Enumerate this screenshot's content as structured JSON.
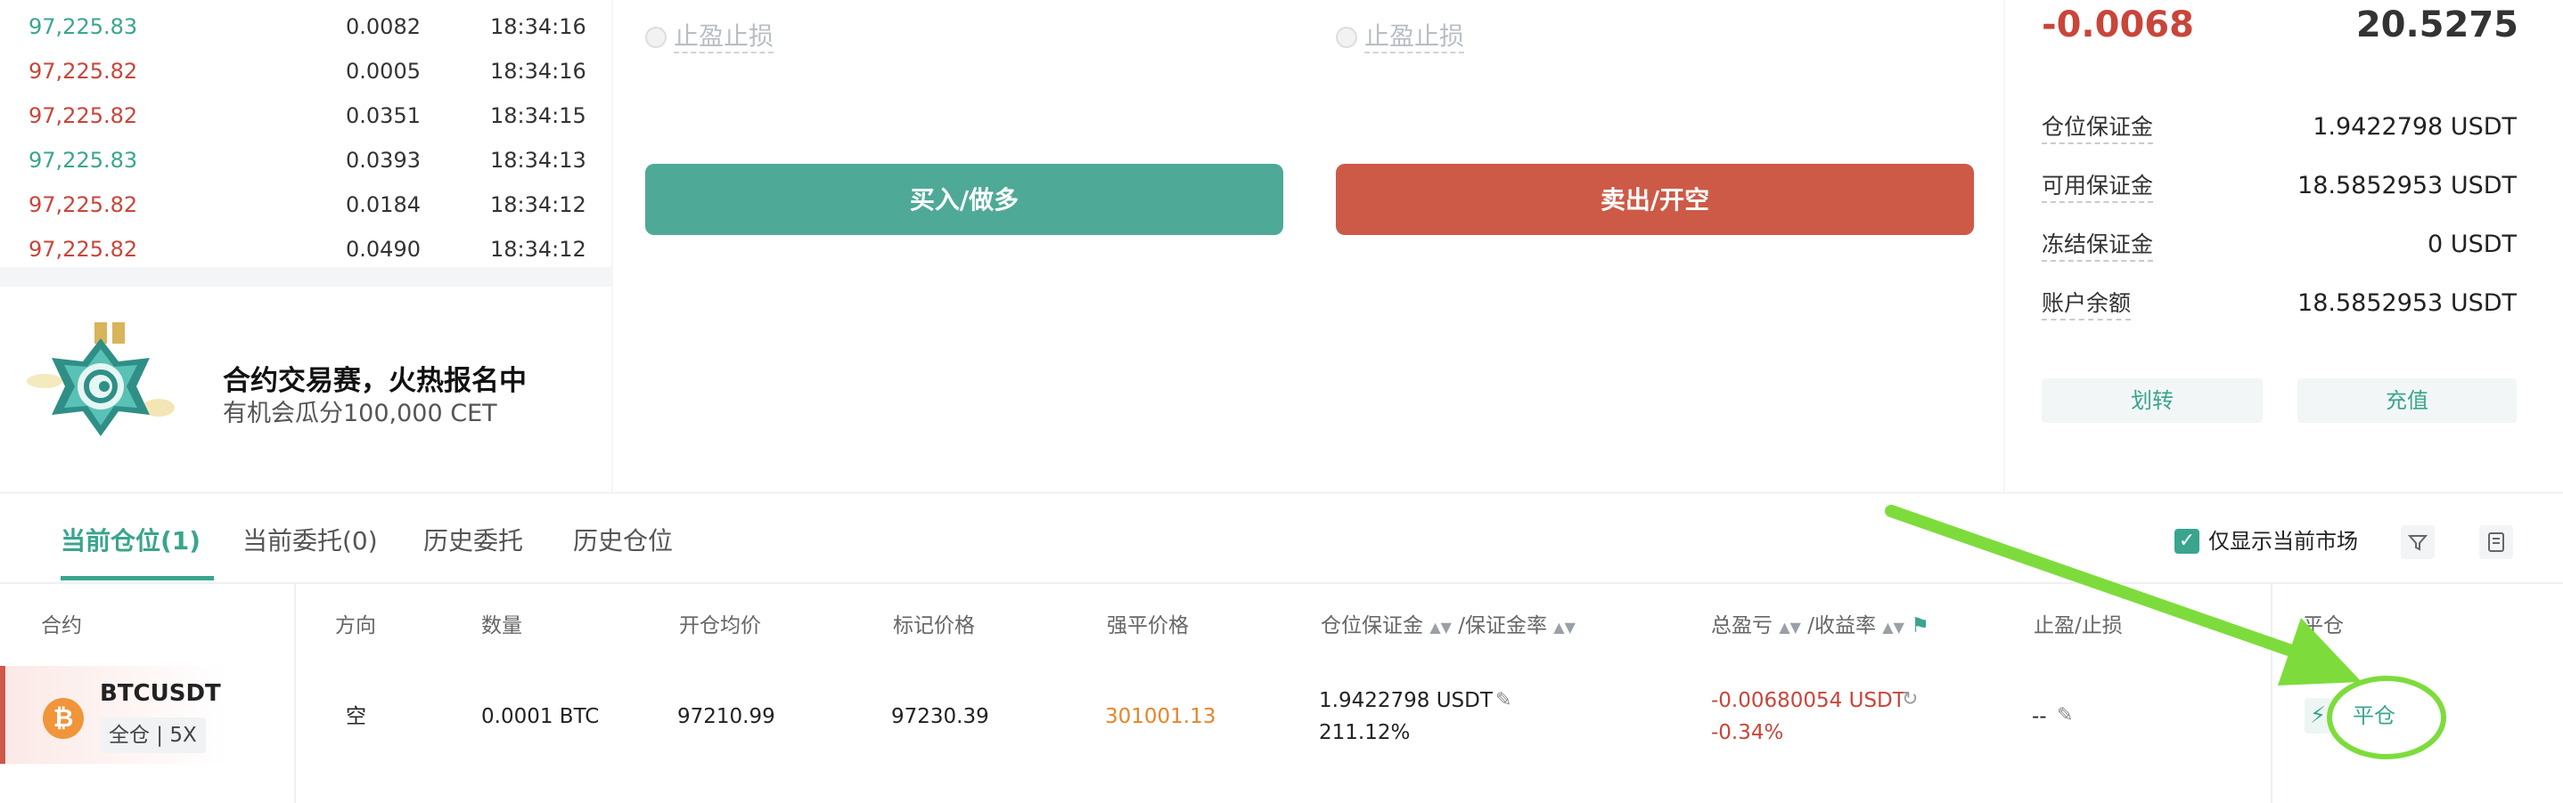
{
  "trades": [
    {
      "price": "97,225.83",
      "qty": "0.0082",
      "time": "18:34:16",
      "dir": "up"
    },
    {
      "price": "97,225.82",
      "qty": "0.0005",
      "time": "18:34:16",
      "dir": "down"
    },
    {
      "price": "97,225.82",
      "qty": "0.0351",
      "time": "18:34:15",
      "dir": "down"
    },
    {
      "price": "97,225.83",
      "qty": "0.0393",
      "time": "18:34:13",
      "dir": "up"
    },
    {
      "price": "97,225.82",
      "qty": "0.0184",
      "time": "18:34:12",
      "dir": "down"
    },
    {
      "price": "97,225.82",
      "qty": "0.0490",
      "time": "18:34:12",
      "dir": "down"
    }
  ],
  "promo": {
    "title": "合约交易赛，火热报名中",
    "subtitle": "有机会瓜分100,000 CET"
  },
  "order": {
    "tpsl_left": "止盈止损",
    "tpsl_right": "止盈止损",
    "buy_label": "买入/做多",
    "sell_label": "卖出/开空"
  },
  "account": {
    "pnl": "-0.0068",
    "equity": "20.5275",
    "rows": [
      {
        "label": "仓位保证金",
        "value": "1.9422798 USDT"
      },
      {
        "label": "可用保证金",
        "value": "18.5852953 USDT"
      },
      {
        "label": "冻结保证金",
        "value": "0 USDT"
      },
      {
        "label": "账户余额",
        "value": "18.5852953 USDT"
      }
    ],
    "transfer_label": "划转",
    "deposit_label": "充值"
  },
  "tabs": [
    "当前仓位(1)",
    "当前委托(0)",
    "历史委托",
    "历史仓位"
  ],
  "filter": {
    "only_current_label": "仅显示当前市场",
    "checked": true
  },
  "table": {
    "headers": {
      "contract": "合约",
      "side": "方向",
      "qty": "数量",
      "entry": "开仓均价",
      "mark": "标记价格",
      "liq": "强平价格",
      "margin": "仓位保证金",
      "margin_ratio": "/保证金率",
      "pnl": "总盈亏",
      "roe": "/收益率",
      "tpsl": "止盈/止损",
      "close": "平仓"
    },
    "row": {
      "symbol": "BTCUSDT",
      "mode": "全仓 | 5X",
      "coin_glyph": "₿",
      "side": "空",
      "qty": "0.0001 BTC",
      "entry": "97210.99",
      "mark": "97230.39",
      "liq": "301001.13",
      "margin": "1.9422798 USDT",
      "margin_ratio": "211.12%",
      "pnl": "-0.00680054 USDT",
      "roe": "-0.34%",
      "tpsl": "--",
      "close_label": "平仓"
    }
  },
  "colors": {
    "green": "#3aa58e",
    "red": "#c9453a",
    "orange": "#e8852a",
    "annotation": "#7ddc3c"
  }
}
